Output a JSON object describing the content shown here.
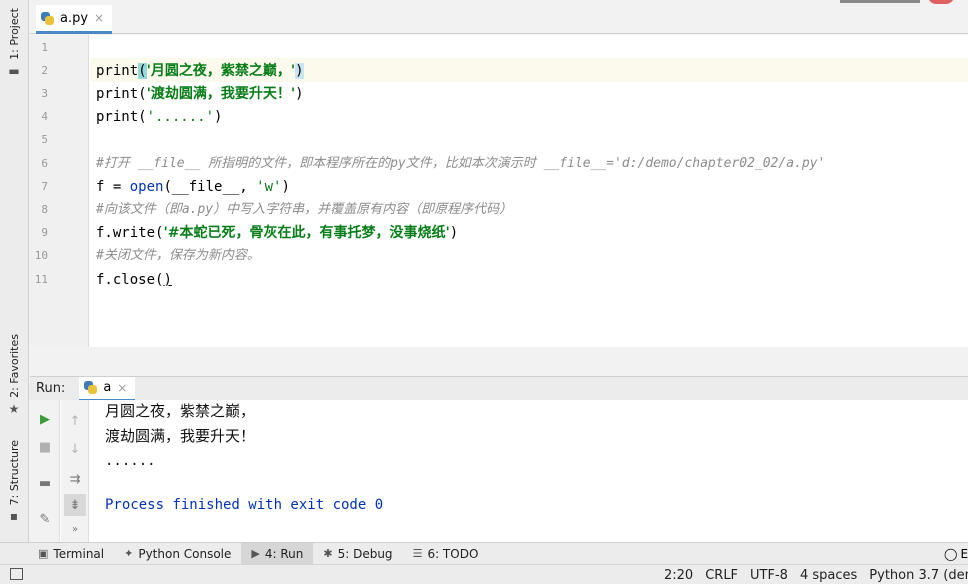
{
  "left_strip": {
    "project": "1: Project",
    "favorites": "2: Favorites",
    "structure": "7: Structure"
  },
  "editor_tab": {
    "filename": "a.py",
    "close": "×"
  },
  "editor": {
    "line_numbers": [
      "1",
      "2",
      "3",
      "4",
      "5",
      "6",
      "7",
      "8",
      "9",
      "10",
      "11"
    ],
    "line2": {
      "fn": "print",
      "open": "(",
      "str": "'月圆之夜，紫禁之巅，'",
      "close": ")"
    },
    "line3": {
      "fn": "print(",
      "str": "'渡劫圆满，我要升天！'",
      "close": ")"
    },
    "line4": {
      "fn": "print(",
      "str": "'......'",
      "close": ")"
    },
    "line6": {
      "comment": "#打开 __file__ 所指明的文件，即本程序所在的py文件，比如本次演示时 __file__='d:/demo/chapter02_02/a.py'"
    },
    "line7": {
      "pre": "f = ",
      "fn": "open",
      "mid": "(__file__, ",
      "str": "'w'",
      "close": ")"
    },
    "line8": {
      "comment": "#向该文件（即a.py）中写入字符串，并覆盖原有内容（即原程序代码）"
    },
    "line9": {
      "fn": "f.write(",
      "str": "'#本蛇已死，骨灰在此，有事托梦，没事烧纸'",
      "close": ")"
    },
    "line10": {
      "comment": "#关闭文件，保存为新内容。"
    },
    "line11": {
      "fn": "f.close",
      "open": "(",
      "close": ")"
    }
  },
  "run_panel": {
    "label": "Run:",
    "tab_name": "a",
    "tab_close": "×",
    "output": [
      "月圆之夜，紫禁之巅，",
      "渡劫圆满，我要升天！",
      "......",
      "Process finished with exit code 0"
    ]
  },
  "tool_windows": {
    "terminal": "Terminal",
    "python_console": "Python Console",
    "run": "4: Run",
    "debug": "5: Debug",
    "todo": "6: TODO",
    "event_log_partial": "E"
  },
  "status_bar": {
    "position": "2:20",
    "line_sep": "CRLF",
    "encoding": "UTF-8",
    "indent": "4 spaces",
    "interpreter": "Python 3.7 (dem"
  }
}
